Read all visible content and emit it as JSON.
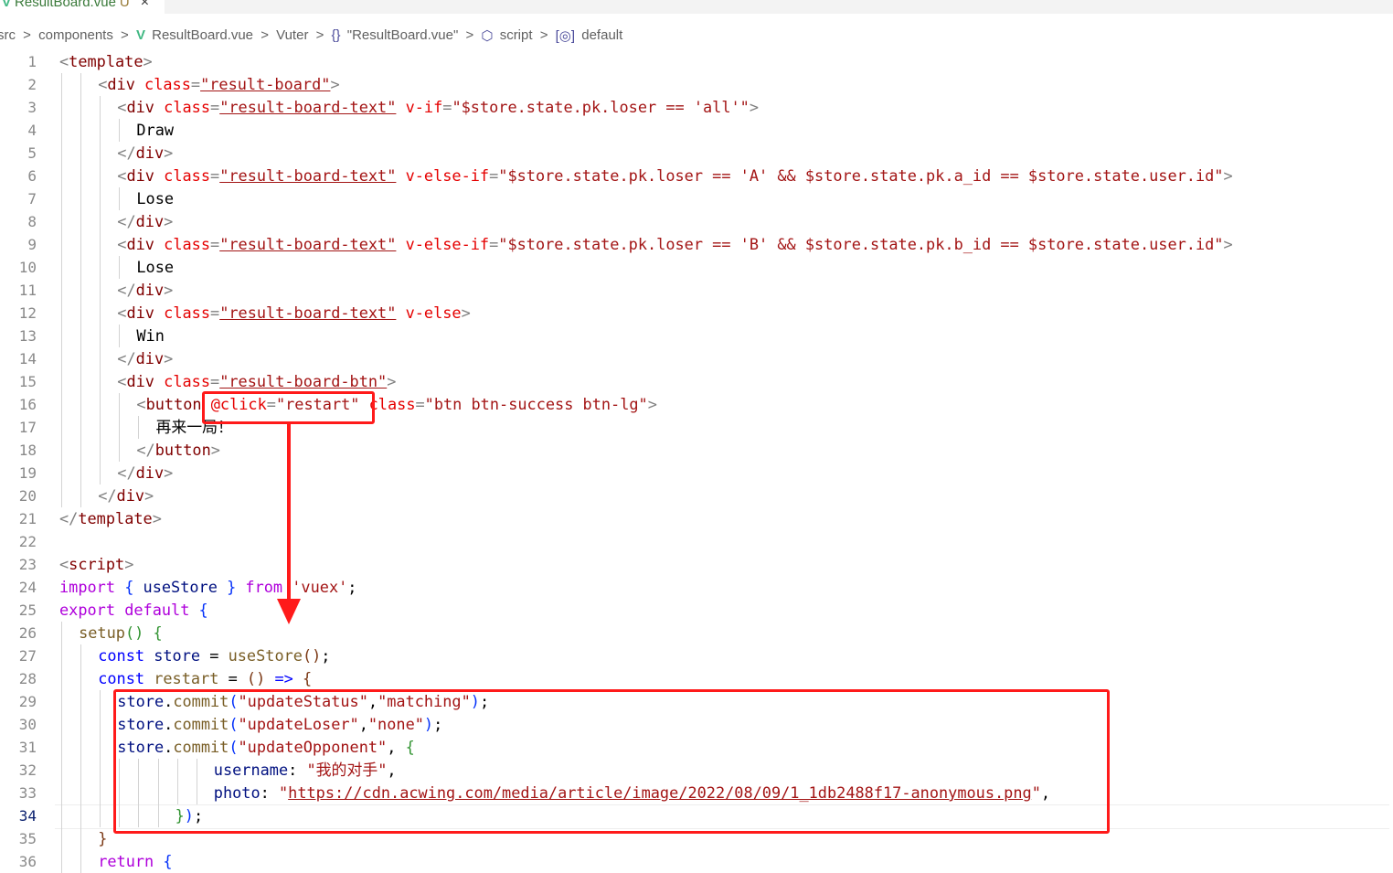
{
  "tab": {
    "filename": "ResultBoard.vue",
    "status": "U",
    "close": "×"
  },
  "breadcrumb": {
    "p1": "src",
    "p2": "components",
    "p3": "ResultBoard.vue",
    "p4": "Vuter",
    "p5": "\"ResultBoard.vue\"",
    "p6": "script",
    "p7": "default",
    "sep": ">",
    "curly": "{}"
  },
  "editor": {
    "current_line": 34,
    "line_numbers": [
      "1",
      "2",
      "3",
      "4",
      "5",
      "6",
      "7",
      "8",
      "9",
      "10",
      "11",
      "12",
      "13",
      "14",
      "15",
      "16",
      "17",
      "18",
      "19",
      "20",
      "21",
      "22",
      "23",
      "24",
      "25",
      "26",
      "27",
      "28",
      "29",
      "30",
      "31",
      "32",
      "33",
      "34",
      "35",
      "36"
    ],
    "lines": [
      [
        "<",
        "template",
        ">"
      ],
      [
        "<",
        "div",
        " ",
        "class",
        "=",
        "\"result-board\"",
        ">"
      ],
      [
        "<",
        "div",
        " ",
        "class",
        "=",
        "\"result-board-text\"",
        " ",
        "v-if",
        "=",
        "\"$store.state.pk.loser == 'all'\"",
        ">"
      ],
      [
        "Draw"
      ],
      [
        "</",
        "div",
        ">"
      ],
      [
        "<",
        "div",
        " ",
        "class",
        "=",
        "\"result-board-text\"",
        " ",
        "v-else-if",
        "=",
        "\"$store.state.pk.loser == 'A' && $store.state.pk.a_id == $store.state.user.id\"",
        ">"
      ],
      [
        "Lose"
      ],
      [
        "</",
        "div",
        ">"
      ],
      [
        "<",
        "div",
        " ",
        "class",
        "=",
        "\"result-board-text\"",
        " ",
        "v-else-if",
        "=",
        "\"$store.state.pk.loser == 'B' && $store.state.pk.b_id == $store.state.user.id\"",
        ">"
      ],
      [
        "Lose"
      ],
      [
        "</",
        "div",
        ">"
      ],
      [
        "<",
        "div",
        " ",
        "class",
        "=",
        "\"result-board-text\"",
        " ",
        "v-else",
        ">"
      ],
      [
        "Win"
      ],
      [
        "</",
        "div",
        ">"
      ],
      [
        "<",
        "div",
        " ",
        "class",
        "=",
        "\"result-board-btn\"",
        ">"
      ],
      [
        "<",
        "button",
        " ",
        "@click",
        "=",
        "\"restart\"",
        " ",
        "class",
        "=",
        "\"btn btn-success btn-lg\"",
        ">"
      ],
      [
        "再来一局！"
      ],
      [
        "</",
        "button",
        ">"
      ],
      [
        "</",
        "div",
        ">"
      ],
      [
        "</",
        "div",
        ">"
      ],
      [
        "</",
        "template",
        ">"
      ],
      [
        ""
      ],
      [
        "<",
        "script",
        ">"
      ],
      [
        "import",
        " ",
        "{",
        " ",
        "useStore",
        " ",
        "}",
        " ",
        "from",
        " ",
        "'vuex'",
        ";"
      ],
      [
        "export",
        " ",
        "default",
        " ",
        "{"
      ],
      [
        "setup",
        "()",
        " ",
        "{"
      ],
      [
        "const",
        " ",
        "store",
        " = ",
        "useStore",
        "()",
        ";"
      ],
      [
        "const",
        " ",
        "restart",
        " = ",
        "()",
        " ",
        "=>",
        " ",
        "{"
      ],
      [
        "store",
        ".",
        "commit",
        "(",
        "\"updateStatus\"",
        ",",
        "\"matching\"",
        ")",
        ";"
      ],
      [
        "store",
        ".",
        "commit",
        "(",
        "\"updateLoser\"",
        ",",
        "\"none\"",
        ")",
        ";"
      ],
      [
        "store",
        ".",
        "commit",
        "(",
        "\"updateOpponent\"",
        ", ",
        "{"
      ],
      [
        "username",
        ": ",
        "\"我的对手\"",
        ","
      ],
      [
        "photo",
        ": ",
        "\"",
        "https://cdn.acwing.com/media/article/image/2022/08/09/1_1db2488f17-anonymous.png",
        "\"",
        ","
      ],
      [
        "}",
        ")",
        ";"
      ],
      [
        "}"
      ],
      [
        "return",
        " ",
        "{"
      ]
    ]
  },
  "colors": {
    "annotation": "#ff1a1a",
    "vue_green": "#41b883"
  }
}
